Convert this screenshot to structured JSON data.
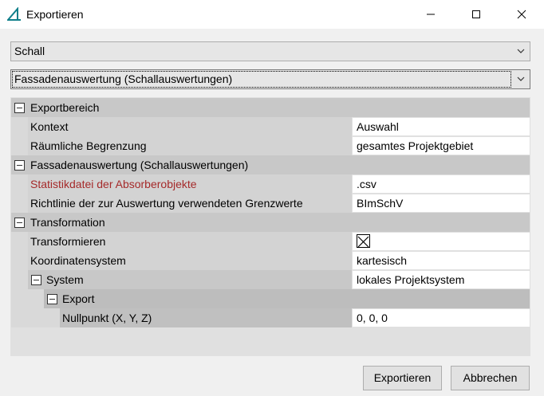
{
  "window": {
    "title": "Exportieren"
  },
  "combos": {
    "category": "Schall",
    "export_type": "Fassadenauswertung (Schallauswertungen)"
  },
  "grid": {
    "exportbereich": {
      "label": "Exportbereich",
      "kontext": {
        "name": "Kontext",
        "value": "Auswahl"
      },
      "begrenzung": {
        "name": "Räumliche Begrenzung",
        "value": "gesamtes Projektgebiet"
      }
    },
    "fassade": {
      "label": "Fassadenauswertung (Schallauswertungen)",
      "statistik": {
        "name": "Statistikdatei der Absorberobjekte",
        "value": ".csv"
      },
      "richtlinie": {
        "name": "Richtlinie der zur Auswertung verwendeten Grenzwerte",
        "value": "BImSchV"
      }
    },
    "transformation": {
      "label": "Transformation",
      "transformieren": {
        "name": "Transformieren",
        "checked": true
      },
      "koordinaten": {
        "name": "Koordinatensystem",
        "value": "kartesisch"
      },
      "system": {
        "label": "System",
        "value": "lokales Projektsystem",
        "export": {
          "label": "Export",
          "nullpunkt": {
            "name": "Nullpunkt (X, Y, Z)",
            "value": "0, 0, 0"
          }
        }
      }
    }
  },
  "buttons": {
    "export": "Exportieren",
    "cancel": "Abbrechen"
  },
  "icons": {
    "app": "triangle-logo-icon",
    "minimize": "minimize-icon",
    "maximize": "maximize-icon",
    "close": "close-icon",
    "dropdown": "chevron-down-icon",
    "collapse": "collapse-minus-icon"
  },
  "colors": {
    "accent": "#0f7f8a",
    "highlight_text": "#a52a2a"
  }
}
